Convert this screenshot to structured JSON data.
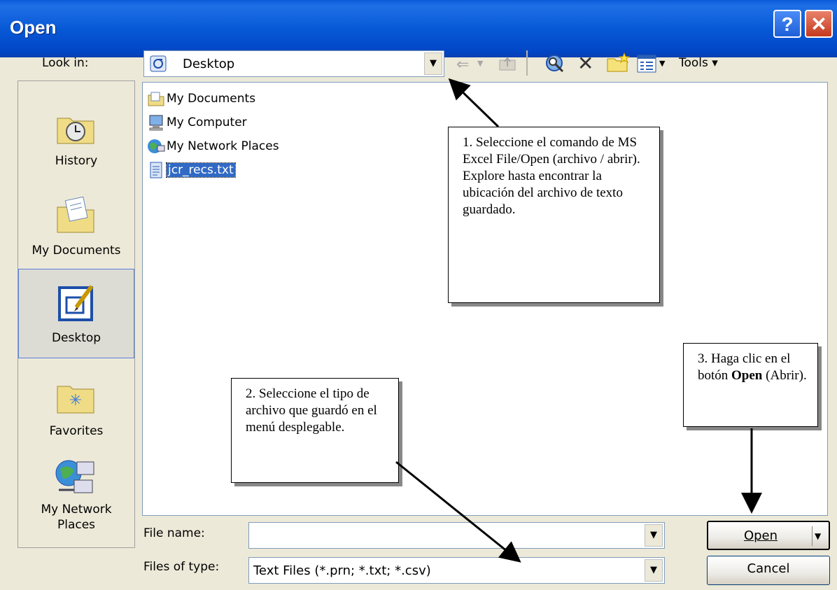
{
  "window": {
    "title": "Open"
  },
  "titlebar_buttons": {
    "help": "?",
    "close": "✕"
  },
  "lookin": {
    "label": "Look in:",
    "value": "Desktop"
  },
  "toolbar": {
    "tools_label": "Tools ▾"
  },
  "places": [
    {
      "label": "History",
      "icon": "history-icon"
    },
    {
      "label": "My Documents",
      "icon": "my-documents-folder-icon"
    },
    {
      "label": "Desktop",
      "icon": "desktop-icon"
    },
    {
      "label": "Favorites",
      "icon": "favorites-folder-icon"
    },
    {
      "label_line1": "My Network",
      "label_line2": "Places",
      "icon": "network-places-icon"
    }
  ],
  "files": [
    {
      "name": "My Documents",
      "icon": "folder-icon"
    },
    {
      "name": "My Computer",
      "icon": "computer-icon"
    },
    {
      "name": "My Network Places",
      "icon": "network-icon"
    },
    {
      "name": "jcr_recs.txt",
      "icon": "text-file-icon"
    }
  ],
  "filename": {
    "label": "File name:",
    "value": ""
  },
  "filetype": {
    "label": "Files of type:",
    "value": "Text Files (*.prn; *.txt; *.csv)"
  },
  "buttons": {
    "open": "Open",
    "cancel": "Cancel"
  },
  "callouts": {
    "c1": "1.  Seleccione el comando de MS Excel File/Open (archivo / abrir). Explore hasta encontrar la ubicación del archivo de texto guardado.",
    "c2": "2.  Seleccione el tipo de archivo que guardó en el menú desplegable.",
    "c3_pre": "3.  Haga clic en el botón ",
    "c3_bold": "Open",
    "c3_post": " (Abrir)."
  },
  "colors": {
    "titlebar": "#0859d6",
    "selection": "#316ac5",
    "dialog_bg": "#ece9d8"
  }
}
